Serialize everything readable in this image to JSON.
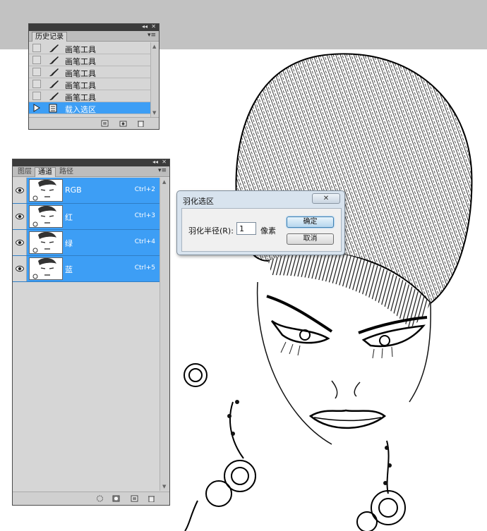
{
  "history": {
    "tab_label": "历史记录",
    "items": [
      {
        "label": "画笔工具",
        "icon": "brush-icon"
      },
      {
        "label": "画笔工具",
        "icon": "brush-icon"
      },
      {
        "label": "画笔工具",
        "icon": "brush-icon"
      },
      {
        "label": "画笔工具",
        "icon": "brush-icon"
      },
      {
        "label": "画笔工具",
        "icon": "brush-icon"
      },
      {
        "label": "载入选区",
        "icon": "load-selection-icon",
        "selected": true
      }
    ]
  },
  "channels": {
    "tabs": [
      "图层",
      "通道",
      "路径"
    ],
    "active_tab": "通道",
    "items": [
      {
        "name": "RGB",
        "shortcut": "Ctrl+2"
      },
      {
        "name": "红",
        "shortcut": "Ctrl+3"
      },
      {
        "name": "绿",
        "shortcut": "Ctrl+4"
      },
      {
        "name": "蓝",
        "shortcut": "Ctrl+5"
      }
    ]
  },
  "feather_dialog": {
    "title": "羽化选区",
    "close_label": "✕",
    "radius_label": "羽化半径(R):",
    "radius_value": "1",
    "unit": "像素",
    "ok_label": "确定",
    "cancel_label": "取消"
  },
  "colors": {
    "selection_blue": "#3d9ef5",
    "panel_gray": "#d6d6d6",
    "dark_titlebar": "#3b3b3b"
  }
}
